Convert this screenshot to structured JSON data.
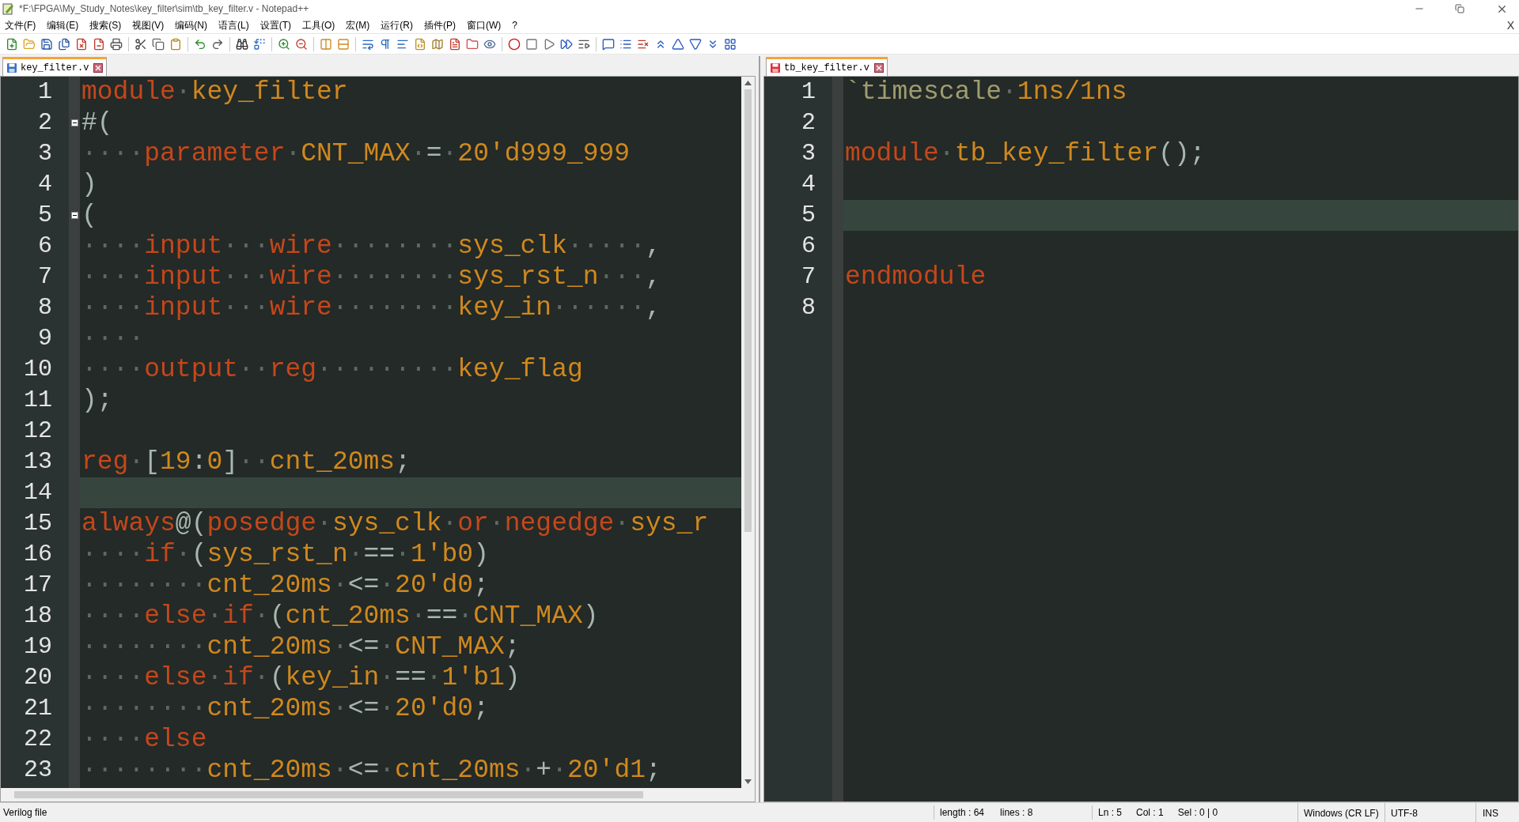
{
  "window": {
    "title": "*F:\\FPGA\\My_Study_Notes\\key_filter\\sim\\tb_key_filter.v - Notepad++"
  },
  "menu": [
    "文件(F)",
    "编辑(E)",
    "搜索(S)",
    "视图(V)",
    "编码(N)",
    "语言(L)",
    "设置(T)",
    "工具(O)",
    "宏(M)",
    "运行(R)",
    "插件(P)",
    "窗口(W)",
    "?"
  ],
  "menu_close": "X",
  "left_pane": {
    "tab": {
      "label": "key_filter.v",
      "selected": true,
      "modified": false
    },
    "lines": [
      {
        "number": "1",
        "current": false,
        "fold_start": false,
        "tokens": [
          {
            "kind": "kw",
            "text": "module"
          },
          {
            "kind": "dot",
            "text": "·"
          },
          {
            "kind": "id",
            "text": "key_filter"
          }
        ]
      },
      {
        "number": "2",
        "current": false,
        "fold_start": true,
        "tokens": [
          {
            "kind": "op",
            "text": "#("
          }
        ]
      },
      {
        "number": "3",
        "current": false,
        "fold_start": false,
        "tokens": [
          {
            "kind": "dot",
            "text": "····"
          },
          {
            "kind": "kw",
            "text": "parameter"
          },
          {
            "kind": "dot",
            "text": "·"
          },
          {
            "kind": "id",
            "text": "CNT_MAX"
          },
          {
            "kind": "dot",
            "text": "·"
          },
          {
            "kind": "op",
            "text": "="
          },
          {
            "kind": "dot",
            "text": "·"
          },
          {
            "kind": "id",
            "text": "20'd999_999"
          }
        ]
      },
      {
        "number": "4",
        "current": false,
        "fold_start": false,
        "tokens": [
          {
            "kind": "op",
            "text": ")"
          }
        ]
      },
      {
        "number": "5",
        "current": false,
        "fold_start": true,
        "tokens": [
          {
            "kind": "op",
            "text": "("
          }
        ]
      },
      {
        "number": "6",
        "current": false,
        "fold_start": false,
        "tokens": [
          {
            "kind": "dot",
            "text": "····"
          },
          {
            "kind": "kw",
            "text": "input"
          },
          {
            "kind": "dot",
            "text": "···"
          },
          {
            "kind": "kw",
            "text": "wire"
          },
          {
            "kind": "dot",
            "text": "········"
          },
          {
            "kind": "id",
            "text": "sys_clk"
          },
          {
            "kind": "dot",
            "text": "·····"
          },
          {
            "kind": "op",
            "text": ","
          }
        ]
      },
      {
        "number": "7",
        "current": false,
        "fold_start": false,
        "tokens": [
          {
            "kind": "dot",
            "text": "····"
          },
          {
            "kind": "kw",
            "text": "input"
          },
          {
            "kind": "dot",
            "text": "···"
          },
          {
            "kind": "kw",
            "text": "wire"
          },
          {
            "kind": "dot",
            "text": "········"
          },
          {
            "kind": "id",
            "text": "sys_rst_n"
          },
          {
            "kind": "dot",
            "text": "···"
          },
          {
            "kind": "op",
            "text": ","
          }
        ]
      },
      {
        "number": "8",
        "current": false,
        "fold_start": false,
        "tokens": [
          {
            "kind": "dot",
            "text": "····"
          },
          {
            "kind": "kw",
            "text": "input"
          },
          {
            "kind": "dot",
            "text": "···"
          },
          {
            "kind": "kw",
            "text": "wire"
          },
          {
            "kind": "dot",
            "text": "········"
          },
          {
            "kind": "id",
            "text": "key_in"
          },
          {
            "kind": "dot",
            "text": "······"
          },
          {
            "kind": "op",
            "text": ","
          }
        ]
      },
      {
        "number": "9",
        "current": false,
        "fold_start": false,
        "tokens": [
          {
            "kind": "dot",
            "text": "····"
          }
        ]
      },
      {
        "number": "10",
        "current": false,
        "fold_start": false,
        "tokens": [
          {
            "kind": "dot",
            "text": "····"
          },
          {
            "kind": "kw",
            "text": "output"
          },
          {
            "kind": "dot",
            "text": "··"
          },
          {
            "kind": "kw",
            "text": "reg"
          },
          {
            "kind": "dot",
            "text": "·········"
          },
          {
            "kind": "id",
            "text": "key_flag"
          }
        ]
      },
      {
        "number": "11",
        "current": false,
        "fold_start": false,
        "tokens": [
          {
            "kind": "op",
            "text": ");"
          }
        ]
      },
      {
        "number": "12",
        "current": false,
        "fold_start": false
      },
      {
        "number": "13",
        "current": false,
        "fold_start": false,
        "tokens": [
          {
            "kind": "kw",
            "text": "reg"
          },
          {
            "kind": "dot",
            "text": "·"
          },
          {
            "kind": "op",
            "text": "["
          },
          {
            "kind": "id",
            "text": "19"
          },
          {
            "kind": "op",
            "text": ":"
          },
          {
            "kind": "id",
            "text": "0"
          },
          {
            "kind": "op",
            "text": "]"
          },
          {
            "kind": "dot",
            "text": "··"
          },
          {
            "kind": "id",
            "text": "cnt_20ms"
          },
          {
            "kind": "op",
            "text": ";"
          }
        ]
      },
      {
        "number": "14",
        "current": true,
        "fold_start": false
      },
      {
        "number": "15",
        "current": false,
        "fold_start": false,
        "tokens": [
          {
            "kind": "kw",
            "text": "always"
          },
          {
            "kind": "op",
            "text": "@("
          },
          {
            "kind": "kw",
            "text": "posedge"
          },
          {
            "kind": "dot",
            "text": "·"
          },
          {
            "kind": "id",
            "text": "sys_clk"
          },
          {
            "kind": "dot",
            "text": "·"
          },
          {
            "kind": "kw",
            "text": "or"
          },
          {
            "kind": "dot",
            "text": "·"
          },
          {
            "kind": "kw",
            "text": "negedge"
          },
          {
            "kind": "dot",
            "text": "·"
          },
          {
            "kind": "id",
            "text": "sys_r"
          }
        ]
      },
      {
        "number": "16",
        "current": false,
        "fold_start": false,
        "tokens": [
          {
            "kind": "dot",
            "text": "····"
          },
          {
            "kind": "kw",
            "text": "if"
          },
          {
            "kind": "dot",
            "text": "·"
          },
          {
            "kind": "op",
            "text": "("
          },
          {
            "kind": "id",
            "text": "sys_rst_n"
          },
          {
            "kind": "dot",
            "text": "·"
          },
          {
            "kind": "op",
            "text": "=="
          },
          {
            "kind": "dot",
            "text": "·"
          },
          {
            "kind": "id",
            "text": "1'b0"
          },
          {
            "kind": "op",
            "text": ")"
          }
        ]
      },
      {
        "number": "17",
        "current": false,
        "fold_start": false,
        "tokens": [
          {
            "kind": "dot",
            "text": "········"
          },
          {
            "kind": "id",
            "text": "cnt_20ms"
          },
          {
            "kind": "dot",
            "text": "·"
          },
          {
            "kind": "op",
            "text": "<="
          },
          {
            "kind": "dot",
            "text": "·"
          },
          {
            "kind": "id",
            "text": "20'd0"
          },
          {
            "kind": "op",
            "text": ";"
          }
        ]
      },
      {
        "number": "18",
        "current": false,
        "fold_start": false,
        "tokens": [
          {
            "kind": "dot",
            "text": "····"
          },
          {
            "kind": "kw",
            "text": "else"
          },
          {
            "kind": "dot",
            "text": "·"
          },
          {
            "kind": "kw",
            "text": "if"
          },
          {
            "kind": "dot",
            "text": "·"
          },
          {
            "kind": "op",
            "text": "("
          },
          {
            "kind": "id",
            "text": "cnt_20ms"
          },
          {
            "kind": "dot",
            "text": "·"
          },
          {
            "kind": "op",
            "text": "=="
          },
          {
            "kind": "dot",
            "text": "·"
          },
          {
            "kind": "id",
            "text": "CNT_MAX"
          },
          {
            "kind": "op",
            "text": ")"
          }
        ]
      },
      {
        "number": "19",
        "current": false,
        "fold_start": false,
        "tokens": [
          {
            "kind": "dot",
            "text": "········"
          },
          {
            "kind": "id",
            "text": "cnt_20ms"
          },
          {
            "kind": "dot",
            "text": "·"
          },
          {
            "kind": "op",
            "text": "<="
          },
          {
            "kind": "dot",
            "text": "·"
          },
          {
            "kind": "id",
            "text": "CNT_MAX"
          },
          {
            "kind": "op",
            "text": ";"
          }
        ]
      },
      {
        "number": "20",
        "current": false,
        "fold_start": false,
        "tokens": [
          {
            "kind": "dot",
            "text": "····"
          },
          {
            "kind": "kw",
            "text": "else"
          },
          {
            "kind": "dot",
            "text": "·"
          },
          {
            "kind": "kw",
            "text": "if"
          },
          {
            "kind": "dot",
            "text": "·"
          },
          {
            "kind": "op",
            "text": "("
          },
          {
            "kind": "id",
            "text": "key_in"
          },
          {
            "kind": "dot",
            "text": "·"
          },
          {
            "kind": "op",
            "text": "=="
          },
          {
            "kind": "dot",
            "text": "·"
          },
          {
            "kind": "id",
            "text": "1'b1"
          },
          {
            "kind": "op",
            "text": ")"
          }
        ]
      },
      {
        "number": "21",
        "current": false,
        "fold_start": false,
        "tokens": [
          {
            "kind": "dot",
            "text": "········"
          },
          {
            "kind": "id",
            "text": "cnt_20ms"
          },
          {
            "kind": "dot",
            "text": "·"
          },
          {
            "kind": "op",
            "text": "<="
          },
          {
            "kind": "dot",
            "text": "·"
          },
          {
            "kind": "id",
            "text": "20'd0"
          },
          {
            "kind": "op",
            "text": ";"
          }
        ]
      },
      {
        "number": "22",
        "current": false,
        "fold_start": false,
        "tokens": [
          {
            "kind": "dot",
            "text": "····"
          },
          {
            "kind": "kw",
            "text": "else"
          }
        ]
      },
      {
        "number": "23",
        "current": false,
        "fold_start": false,
        "tokens": [
          {
            "kind": "dot",
            "text": "········"
          },
          {
            "kind": "id",
            "text": "cnt_20ms"
          },
          {
            "kind": "dot",
            "text": "·"
          },
          {
            "kind": "op",
            "text": "<="
          },
          {
            "kind": "dot",
            "text": "·"
          },
          {
            "kind": "id",
            "text": "cnt_20ms"
          },
          {
            "kind": "dot",
            "text": "·"
          },
          {
            "kind": "op",
            "text": "+"
          },
          {
            "kind": "dot",
            "text": "·"
          },
          {
            "kind": "id",
            "text": "20'd1"
          },
          {
            "kind": "op",
            "text": ";"
          }
        ]
      }
    ]
  },
  "right_pane": {
    "tab": {
      "label": "tb_key_filter.v",
      "selected": true,
      "modified": true
    },
    "lines": [
      {
        "number": "1",
        "current": false,
        "tokens": [
          {
            "kind": "directive",
            "text": "`timescale"
          },
          {
            "kind": "dot",
            "text": "·"
          },
          {
            "kind": "id",
            "text": "1ns/1ns"
          }
        ]
      },
      {
        "number": "2",
        "current": false
      },
      {
        "number": "3",
        "current": false,
        "tokens": [
          {
            "kind": "kw",
            "text": "module"
          },
          {
            "kind": "dot",
            "text": "·"
          },
          {
            "kind": "id",
            "text": "tb_key_filter"
          },
          {
            "kind": "op",
            "text": "();"
          }
        ]
      },
      {
        "number": "4",
        "current": false
      },
      {
        "number": "5",
        "current": true
      },
      {
        "number": "6",
        "current": false
      },
      {
        "number": "7",
        "current": false,
        "tokens": [
          {
            "kind": "kw",
            "text": "endmodule"
          }
        ]
      },
      {
        "number": "8",
        "current": false
      }
    ]
  },
  "status_bar": {
    "file_type": "Verilog file",
    "length": "length : 64",
    "lines": "lines : 8",
    "ln": "Ln : 5",
    "col": "Col : 1",
    "sel": "Sel : 0 | 0",
    "eol": "Windows (CR LF)",
    "encoding": "UTF-8",
    "mode": "INS"
  }
}
